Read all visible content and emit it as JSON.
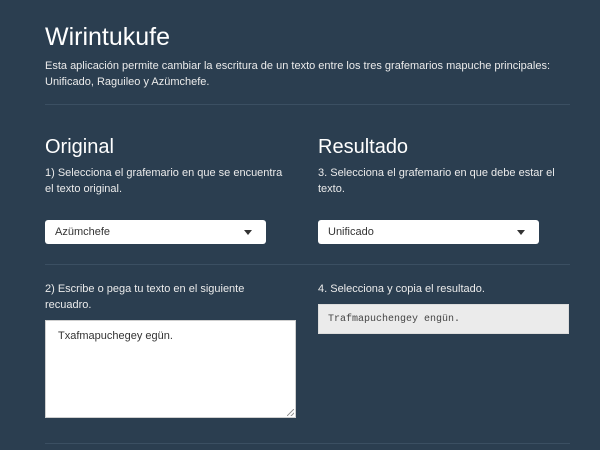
{
  "header": {
    "title": "Wirintukufe",
    "description": "Esta aplicación permite cambiar la escritura de un texto entre los tres grafemarios mapuche principales: Unificado, Raguileo y Azümchefe."
  },
  "original": {
    "title": "Original",
    "step1": "1) Selecciona el grafemario en que se encuentra el texto original.",
    "select_value": "Azümchefe",
    "step2": "2) Escribe o pega tu texto en el siguiente recuadro.",
    "input_text": "Txafmapuchegey egün."
  },
  "result": {
    "title": "Resultado",
    "step3": "3. Selecciona el grafemario en que debe estar el texto.",
    "select_value": "Unificado",
    "step4": "4. Selecciona y copia el resultado.",
    "output_text": "Trafmapuchengey engün."
  },
  "icons": {
    "select_caret": "caret-down-icon",
    "resize": "resize-handle-icon"
  },
  "colors": {
    "background": "#2b3e50",
    "text": "#ebebeb",
    "divider": "#3b4f62",
    "input_bg": "#ffffff",
    "output_bg": "#ebebeb"
  }
}
